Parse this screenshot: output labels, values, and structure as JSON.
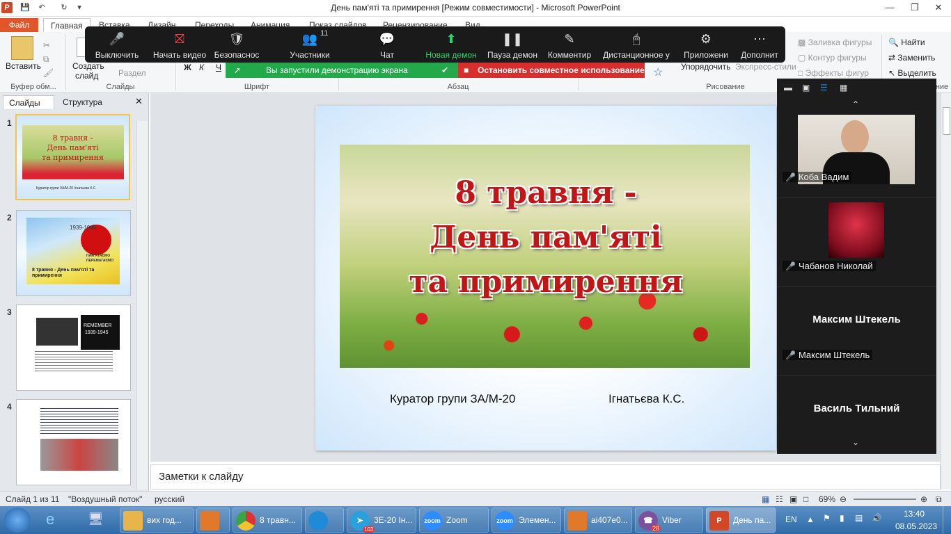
{
  "window": {
    "title": "День пам'яті та примирення [Режим совместимости]  -  Microsoft PowerPoint"
  },
  "quick_access": {
    "app_icon": "P",
    "save_icon": "save-icon",
    "undo_icon": "undo-icon",
    "redo_icon": "redo-icon",
    "customize_icon": "customize-icon"
  },
  "window_controls": {
    "minimize": "—",
    "restore": "❐",
    "close": "✕"
  },
  "ribbon": {
    "tabs": [
      "Файл",
      "Главная",
      "Вставка",
      "Дизайн",
      "Переходы",
      "Анимация",
      "Показ слайдов",
      "Рецензирование",
      "Вид"
    ],
    "clipboard": {
      "paste": "Вставить",
      "group": "Буфер обм..."
    },
    "slides": {
      "create": "Создать",
      "create2": "слайд",
      "section": "Раздел",
      "group": "Слайды"
    },
    "font": {
      "group": "Шрифт",
      "bold": "Ж",
      "italic": "К",
      "underline": "Ч"
    },
    "paragraph": {
      "group": "Абзац"
    },
    "drawing": {
      "group": "Рисование",
      "fill": "Заливка фигуры",
      "outline": "Контур фигуры",
      "effects": "Эффекты фигур",
      "arrange": "Упорядочить",
      "styles": "Экспресс-стили"
    },
    "editing": {
      "find": "Найти",
      "replace": "Заменить",
      "select": "Выделить",
      "group": "ние"
    }
  },
  "zoom": {
    "toolbar": [
      {
        "label": "Выключить",
        "icon": "mic-icon"
      },
      {
        "label": "Начать видео",
        "icon": "video-off-icon"
      },
      {
        "label": "Безопаснос",
        "icon": "shield-icon"
      },
      {
        "label": "Участники",
        "icon": "participants-icon",
        "badge": "11"
      },
      {
        "label": "Чат",
        "icon": "chat-icon"
      },
      {
        "label": "Новая демон",
        "icon": "share-screen-icon"
      },
      {
        "label": "Пауза демон",
        "icon": "pause-icon"
      },
      {
        "label": "Комментир",
        "icon": "annotate-icon"
      },
      {
        "label": "Дистанционное у",
        "icon": "remote-control-icon"
      },
      {
        "label": "Приложени",
        "icon": "apps-icon"
      },
      {
        "label": "Дополнит",
        "icon": "more-icon"
      }
    ],
    "share_notice": "Вы запустили демонстрацию экрана",
    "stop_share": "Остановить совместное использование",
    "participants": [
      {
        "name": "Коба Вадим",
        "type": "video"
      },
      {
        "name": "Чабанов Николай",
        "type": "avatar"
      },
      {
        "name": "Максим Штекель",
        "big": "Максим Штекель",
        "type": "name"
      },
      {
        "name": "Василь Тильний",
        "big": "Василь Тильний",
        "type": "name"
      }
    ]
  },
  "slides_panel": {
    "tabs": [
      "Слайды",
      "Структура"
    ],
    "numbers": [
      "1",
      "2",
      "3",
      "4"
    ],
    "thumb1": {
      "title1": "8 травня -",
      "title2": "День пам'яті",
      "title3": "та примирення",
      "foot": "Куратор групи ЗА/М-20              Ігнатьєва К.С."
    },
    "thumb2": {
      "years": "1939-1945",
      "remember": "ПАМ'ЯТАЄМО",
      "win": "ПЕРЕМАГАЄМО",
      "title": "8 травня - День пам'яті та примирення"
    },
    "thumb3": {
      "remember": "REMEMBER",
      "years": "1939-1945"
    }
  },
  "slide": {
    "line1": "8 травня -",
    "line2": "День пам'яті",
    "line3": "та примирення",
    "curator": "Куратор  групи  ЗА/М-20",
    "teacher": "Ігнатьєва К.С."
  },
  "notes": {
    "placeholder": "Заметки к слайду"
  },
  "status": {
    "slide": "Слайд 1 из 11",
    "theme": "\"Воздушный поток\"",
    "lang": "русский",
    "zoom": "69%"
  },
  "taskbar": {
    "items": [
      {
        "label": "вих год...",
        "icon": "folder-icon",
        "color": "#e8b54a"
      },
      {
        "label": "",
        "icon": "media-icon",
        "color": "#e07a2a"
      },
      {
        "label": "8 травн...",
        "icon": "chrome-icon",
        "color": "#4aa84a"
      },
      {
        "label": "",
        "icon": "edge-icon",
        "color": "#1f8ad6"
      },
      {
        "label": "3Е-20 Ін...",
        "icon": "telegram-icon",
        "color": "#2aa1da"
      },
      {
        "label": "Zoom",
        "icon": "zoom-icon",
        "color": "#2d8cff"
      },
      {
        "label": "Элемен...",
        "icon": "zoom-icon",
        "color": "#2d8cff"
      },
      {
        "label": "ai407e0...",
        "icon": "pdf-icon",
        "color": "#e07a2a"
      },
      {
        "label": "Viber",
        "icon": "viber-icon",
        "color": "#7b519d"
      },
      {
        "label": "День па...",
        "icon": "powerpoint-icon",
        "color": "#d24726"
      }
    ],
    "badges": {
      "telegram": "103",
      "viber": "28"
    },
    "lang": "EN",
    "time": "13:40",
    "date": "08.05.2023"
  }
}
